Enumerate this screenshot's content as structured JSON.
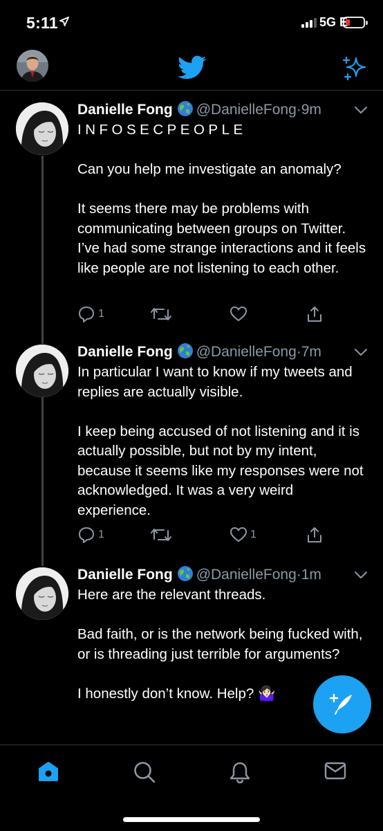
{
  "status_bar": {
    "time": "5:11",
    "network": "5G E"
  },
  "tweets": [
    {
      "name": "Danielle Fong",
      "handle": "@DanielleFong",
      "separator": "·",
      "time": "9m",
      "first_line": "INFOSECPEOPLE",
      "body": "Can you help me investigate an anomaly?\n\nIt seems there may be problems with communicating between groups on Twitter. I’ve had some strange interactions and it feels like people are not listening to each other.",
      "reply_count": "1",
      "retweet_count": "",
      "like_count": ""
    },
    {
      "name": "Danielle Fong",
      "handle": "@DanielleFong",
      "separator": "·",
      "time": "7m",
      "body": "In particular I want to know if my tweets and replies are actually visible.\n\nI keep being accused of not listening and it is actually possible, but not by my intent, because it seems like my responses were not acknowledged. It was a very weird experience.",
      "reply_count": "1",
      "retweet_count": "",
      "like_count": "1"
    },
    {
      "name": "Danielle Fong",
      "handle": "@DanielleFong",
      "separator": "·",
      "time": "1m",
      "body": "Here are the relevant threads.\n\nBad faith, or is the network being fucked with, or is threading just terrible for arguments?\n\nI honestly don’t know. Help?",
      "emoji": "🤷🏻‍♀️"
    }
  ],
  "icons": {
    "brand": "twitter-bird-icon",
    "timeline_toggle": "sparkle-icon",
    "compose": "compose-tweet-icon",
    "tabs": [
      "home-icon",
      "search-icon",
      "notifications-icon",
      "messages-icon"
    ]
  },
  "colors": {
    "accent": "#1da1f2",
    "background": "#000000",
    "muted": "#8b98a5",
    "divider": "#2f3336"
  }
}
